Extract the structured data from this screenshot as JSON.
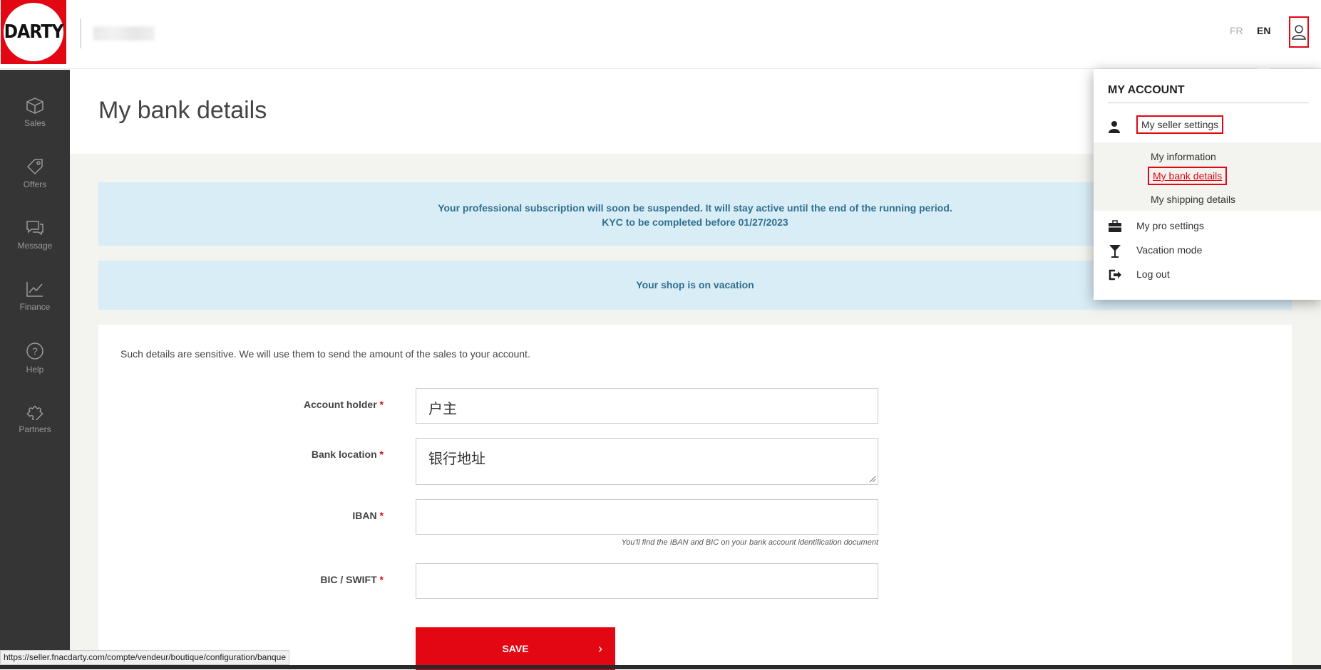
{
  "header": {
    "logo_text": "DARTY",
    "lang_fr": "FR",
    "lang_en": "EN"
  },
  "sidebar": {
    "items": [
      {
        "label": "Sales",
        "icon": "box-icon"
      },
      {
        "label": "Offers",
        "icon": "tag-icon"
      },
      {
        "label": "Message",
        "icon": "chat-icon"
      },
      {
        "label": "Finance",
        "icon": "chart-line-icon"
      },
      {
        "label": "Help",
        "icon": "question-icon"
      },
      {
        "label": "Partners",
        "icon": "puzzle-icon"
      }
    ]
  },
  "page": {
    "title": "My bank details"
  },
  "alerts": {
    "subscription_line1": "Your professional subscription will soon be suspended. It will stay active until the end of the running period.",
    "subscription_line2": "KYC to be completed before 01/27/2023",
    "vacation": "Your shop is on vacation"
  },
  "form": {
    "intro": "Such details are sensitive. We will use them to send the amount of the sales to your account.",
    "account_holder_label": "Account holder",
    "account_holder_value": "户主",
    "bank_location_label": "Bank location",
    "bank_location_value": "银行地址",
    "iban_label": "IBAN",
    "iban_value": "",
    "iban_hint": "You'll find the IBAN and BIC on your bank account identification document",
    "bic_label": "BIC / SWIFT",
    "bic_value": "",
    "required_mark": "*",
    "save_label": "SAVE"
  },
  "account_menu": {
    "title": "MY ACCOUNT",
    "seller_settings": "My seller settings",
    "my_information": "My information",
    "my_bank_details": "My bank details",
    "my_shipping_details": "My shipping details",
    "pro_settings": "My pro settings",
    "vacation_mode": "Vacation mode",
    "log_out": "Log out"
  },
  "statusbar": {
    "url": "https://seller.fnacdarty.com/compte/vendeur/boutique/configuration/banque"
  },
  "colors": {
    "brand_red": "#e30613",
    "sidebar_bg": "#353535",
    "alert_bg": "#d9edf7",
    "alert_text": "#31708f"
  }
}
